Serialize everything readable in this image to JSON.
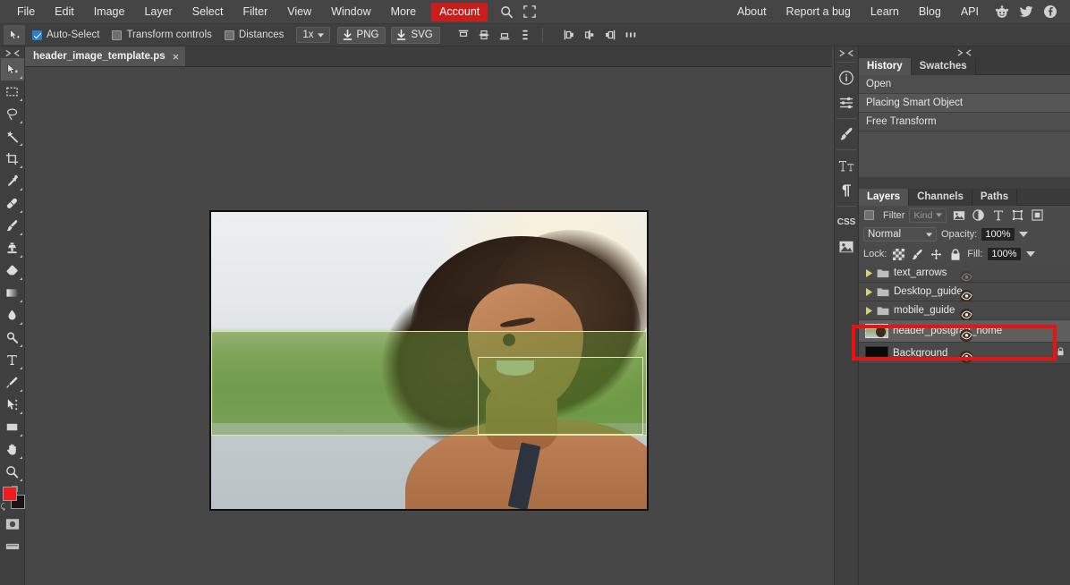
{
  "menu": {
    "items": [
      {
        "label": "File",
        "name": "menu-file"
      },
      {
        "label": "Edit",
        "name": "menu-edit"
      },
      {
        "label": "Image",
        "name": "menu-image"
      },
      {
        "label": "Layer",
        "name": "menu-layer"
      },
      {
        "label": "Select",
        "name": "menu-select"
      },
      {
        "label": "Filter",
        "name": "menu-filter"
      },
      {
        "label": "View",
        "name": "menu-view"
      },
      {
        "label": "Window",
        "name": "menu-window"
      },
      {
        "label": "More",
        "name": "menu-more"
      }
    ],
    "account_label": "Account",
    "account_color": "#cc1d1d",
    "search_icon": "search-icon",
    "fullscreen_icon": "fullscreen-icon",
    "right_links": [
      {
        "label": "About",
        "name": "link-about"
      },
      {
        "label": "Report a bug",
        "name": "link-report-a-bug"
      },
      {
        "label": "Learn",
        "name": "link-learn"
      },
      {
        "label": "Blog",
        "name": "link-blog"
      },
      {
        "label": "API",
        "name": "link-api"
      }
    ],
    "social": [
      "reddit-icon",
      "twitter-icon",
      "facebook-icon"
    ]
  },
  "options": {
    "active_tool_icon": "move-tool-icon",
    "auto_select": {
      "label": "Auto-Select",
      "checked": true
    },
    "transform_controls": {
      "label": "Transform controls",
      "checked": false
    },
    "distances": {
      "label": "Distances",
      "checked": false
    },
    "zoom_level": "1x",
    "png_label": "PNG",
    "svg_label": "SVG",
    "align_vertical": [
      "align-top-icon",
      "align-middle-icon",
      "align-bottom-icon",
      "distribute-vertical-icon"
    ],
    "align_horizontal": [
      "align-left-icon",
      "align-center-icon",
      "align-right-icon",
      "distribute-horizontal-icon"
    ]
  },
  "document": {
    "tab_label": "header_image_template.ps",
    "close_label": "×"
  },
  "tools": [
    {
      "name": "move-tool",
      "icon": "move-arrow-icon",
      "active": true
    },
    {
      "name": "marquee-tool",
      "icon": "rectangular-marquee-icon",
      "active": false
    },
    {
      "name": "lasso-tool",
      "icon": "lasso-icon",
      "active": false
    },
    {
      "name": "magic-wand-tool",
      "icon": "magic-wand-icon",
      "active": false
    },
    {
      "name": "crop-tool",
      "icon": "crop-icon",
      "active": false
    },
    {
      "name": "eyedropper-tool",
      "icon": "eyedropper-icon",
      "active": false
    },
    {
      "name": "healing-brush-tool",
      "icon": "healing-patch-icon",
      "active": false
    },
    {
      "name": "brush-tool",
      "icon": "paintbrush-icon",
      "active": false
    },
    {
      "name": "clone-stamp-tool",
      "icon": "clone-stamp-icon",
      "active": false
    },
    {
      "name": "eraser-tool",
      "icon": "eraser-icon",
      "active": false
    },
    {
      "name": "gradient-tool",
      "icon": "gradient-icon",
      "active": false
    },
    {
      "name": "blur-tool",
      "icon": "blur-droplet-icon",
      "active": false
    },
    {
      "name": "dodge-tool",
      "icon": "dodge-icon",
      "active": false
    },
    {
      "name": "type-tool",
      "icon": "type-t-icon",
      "active": false
    },
    {
      "name": "pen-tool",
      "icon": "pen-icon",
      "active": false
    },
    {
      "name": "path-select-tool",
      "icon": "path-select-arrow-icon",
      "active": false
    },
    {
      "name": "shape-tool",
      "icon": "rectangle-shape-icon",
      "active": false
    },
    {
      "name": "hand-tool",
      "icon": "hand-icon",
      "active": false
    },
    {
      "name": "zoom-tool",
      "icon": "magnifier-icon",
      "active": false
    }
  ],
  "tool_extras": {
    "foreground_color": "#ee1c1c",
    "background_color": "#151515",
    "quick_mask_icon": "quick-mask-icon",
    "screen_mode_icon": "screen-mode-icon"
  },
  "right_rail": [
    {
      "name": "rail-info",
      "icon": "info-circle-icon"
    },
    {
      "name": "rail-adjustments",
      "icon": "sliders-icon"
    },
    {
      "name": "rail-brush-settings",
      "icon": "brush-icon"
    },
    {
      "name": "rail-character",
      "icon": "character-tt-icon"
    },
    {
      "name": "rail-paragraph",
      "icon": "paragraph-pilcrow-icon"
    },
    {
      "name": "rail-css",
      "icon": "css-icon"
    },
    {
      "name": "rail-image",
      "icon": "image-icon"
    }
  ],
  "history_panel": {
    "tabs": [
      {
        "label": "History",
        "active": true
      },
      {
        "label": "Swatches",
        "active": false
      }
    ],
    "entries": [
      {
        "label": "Open"
      },
      {
        "label": "Placing Smart Object"
      },
      {
        "label": "Free Transform"
      }
    ]
  },
  "layers_panel": {
    "tabs": [
      {
        "label": "Layers",
        "active": true
      },
      {
        "label": "Channels",
        "active": false
      },
      {
        "label": "Paths",
        "active": false
      }
    ],
    "filter_label": "Filter",
    "kind_label": "Kind",
    "filter_icons": [
      "filter-pixel-icon",
      "filter-adjustment-icon",
      "filter-type-icon",
      "filter-shape-icon",
      "filter-smart-object-icon"
    ],
    "blend_mode": "Normal",
    "opacity_label": "Opacity:",
    "opacity_value": "100%",
    "lock_label": "Lock:",
    "lock_icons": [
      "lock-transparent-pixels-icon",
      "lock-image-pixels-icon",
      "lock-position-icon",
      "lock-all-icon"
    ],
    "fill_label": "Fill:",
    "fill_value": "100%",
    "layers": [
      {
        "name": "text_arrows",
        "type": "group",
        "visible": false,
        "selected": false
      },
      {
        "name": "Desktop_guide",
        "type": "group",
        "visible": true,
        "selected": false
      },
      {
        "name": "mobile_guide",
        "type": "group",
        "visible": true,
        "selected": false
      },
      {
        "name": "header_postgrad_home",
        "type": "smart-object",
        "visible": true,
        "selected": true
      },
      {
        "name": "Background",
        "type": "locked-layer",
        "visible": true,
        "selected": false
      }
    ]
  },
  "annotation": {
    "highlight_color": "#ee1111",
    "target_layer": "header_postgrad_home"
  }
}
